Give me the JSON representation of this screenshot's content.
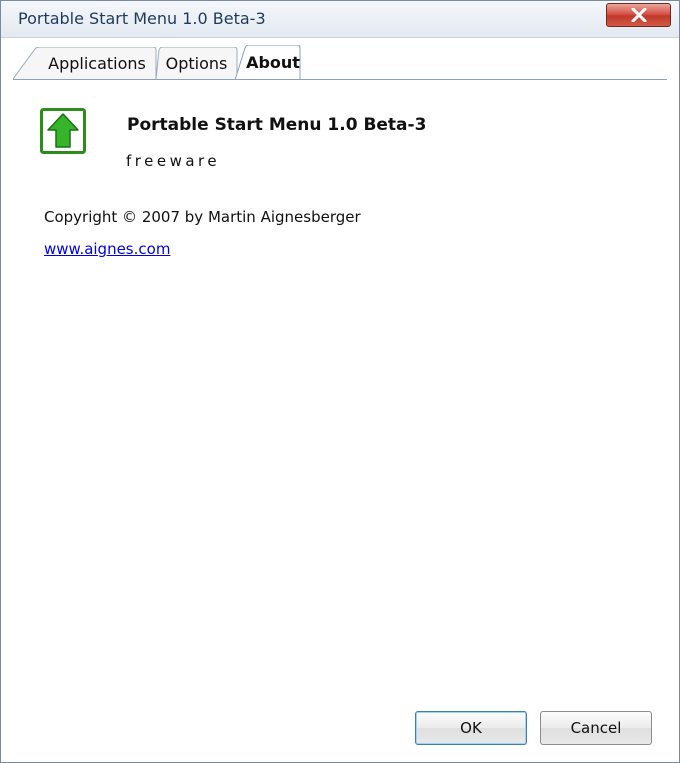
{
  "window": {
    "title": "Portable Start Menu 1.0 Beta-3"
  },
  "tabs": [
    {
      "label": "Applications"
    },
    {
      "label": "Options"
    },
    {
      "label": "About"
    }
  ],
  "about": {
    "app_name": "Portable Start Menu 1.0 Beta-3",
    "license": "freeware",
    "copyright": "Copyright © 2007 by Martin Aignesberger",
    "website": "www.aignes.com"
  },
  "buttons": {
    "ok_label": "OK",
    "cancel_label": "Cancel"
  },
  "icons": {
    "app": "green-up-arrow-icon",
    "close": "close-icon"
  },
  "colors": {
    "icon_green": "#2eaa1e",
    "link": "#0000ee",
    "close_red": "#d9534a"
  }
}
